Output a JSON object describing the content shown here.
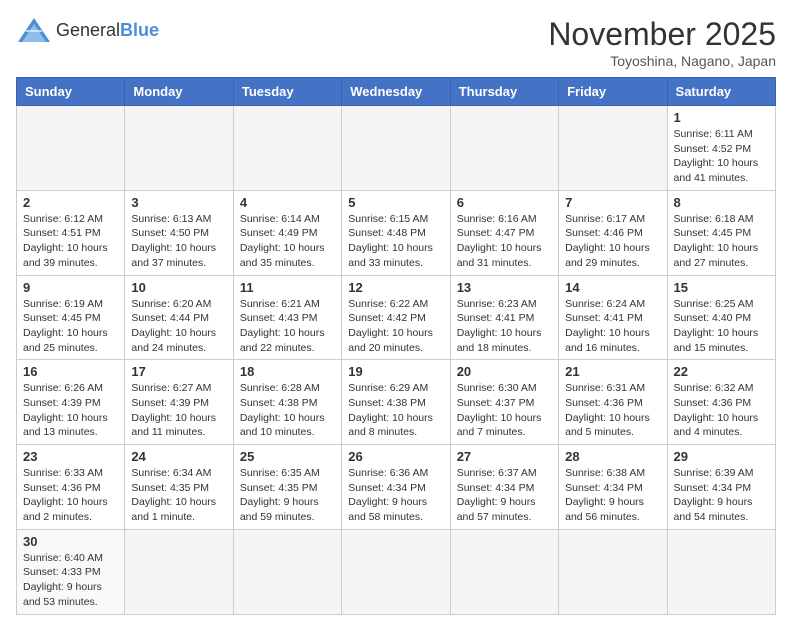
{
  "header": {
    "logo_general": "General",
    "logo_blue": "Blue",
    "title": "November 2025",
    "subtitle": "Toyoshina, Nagano, Japan"
  },
  "weekdays": [
    "Sunday",
    "Monday",
    "Tuesday",
    "Wednesday",
    "Thursday",
    "Friday",
    "Saturday"
  ],
  "weeks": [
    [
      {
        "day": "",
        "info": ""
      },
      {
        "day": "",
        "info": ""
      },
      {
        "day": "",
        "info": ""
      },
      {
        "day": "",
        "info": ""
      },
      {
        "day": "",
        "info": ""
      },
      {
        "day": "",
        "info": ""
      },
      {
        "day": "1",
        "info": "Sunrise: 6:11 AM\nSunset: 4:52 PM\nDaylight: 10 hours and 41 minutes."
      }
    ],
    [
      {
        "day": "2",
        "info": "Sunrise: 6:12 AM\nSunset: 4:51 PM\nDaylight: 10 hours and 39 minutes."
      },
      {
        "day": "3",
        "info": "Sunrise: 6:13 AM\nSunset: 4:50 PM\nDaylight: 10 hours and 37 minutes."
      },
      {
        "day": "4",
        "info": "Sunrise: 6:14 AM\nSunset: 4:49 PM\nDaylight: 10 hours and 35 minutes."
      },
      {
        "day": "5",
        "info": "Sunrise: 6:15 AM\nSunset: 4:48 PM\nDaylight: 10 hours and 33 minutes."
      },
      {
        "day": "6",
        "info": "Sunrise: 6:16 AM\nSunset: 4:47 PM\nDaylight: 10 hours and 31 minutes."
      },
      {
        "day": "7",
        "info": "Sunrise: 6:17 AM\nSunset: 4:46 PM\nDaylight: 10 hours and 29 minutes."
      },
      {
        "day": "8",
        "info": "Sunrise: 6:18 AM\nSunset: 4:45 PM\nDaylight: 10 hours and 27 minutes."
      }
    ],
    [
      {
        "day": "9",
        "info": "Sunrise: 6:19 AM\nSunset: 4:45 PM\nDaylight: 10 hours and 25 minutes."
      },
      {
        "day": "10",
        "info": "Sunrise: 6:20 AM\nSunset: 4:44 PM\nDaylight: 10 hours and 24 minutes."
      },
      {
        "day": "11",
        "info": "Sunrise: 6:21 AM\nSunset: 4:43 PM\nDaylight: 10 hours and 22 minutes."
      },
      {
        "day": "12",
        "info": "Sunrise: 6:22 AM\nSunset: 4:42 PM\nDaylight: 10 hours and 20 minutes."
      },
      {
        "day": "13",
        "info": "Sunrise: 6:23 AM\nSunset: 4:41 PM\nDaylight: 10 hours and 18 minutes."
      },
      {
        "day": "14",
        "info": "Sunrise: 6:24 AM\nSunset: 4:41 PM\nDaylight: 10 hours and 16 minutes."
      },
      {
        "day": "15",
        "info": "Sunrise: 6:25 AM\nSunset: 4:40 PM\nDaylight: 10 hours and 15 minutes."
      }
    ],
    [
      {
        "day": "16",
        "info": "Sunrise: 6:26 AM\nSunset: 4:39 PM\nDaylight: 10 hours and 13 minutes."
      },
      {
        "day": "17",
        "info": "Sunrise: 6:27 AM\nSunset: 4:39 PM\nDaylight: 10 hours and 11 minutes."
      },
      {
        "day": "18",
        "info": "Sunrise: 6:28 AM\nSunset: 4:38 PM\nDaylight: 10 hours and 10 minutes."
      },
      {
        "day": "19",
        "info": "Sunrise: 6:29 AM\nSunset: 4:38 PM\nDaylight: 10 hours and 8 minutes."
      },
      {
        "day": "20",
        "info": "Sunrise: 6:30 AM\nSunset: 4:37 PM\nDaylight: 10 hours and 7 minutes."
      },
      {
        "day": "21",
        "info": "Sunrise: 6:31 AM\nSunset: 4:36 PM\nDaylight: 10 hours and 5 minutes."
      },
      {
        "day": "22",
        "info": "Sunrise: 6:32 AM\nSunset: 4:36 PM\nDaylight: 10 hours and 4 minutes."
      }
    ],
    [
      {
        "day": "23",
        "info": "Sunrise: 6:33 AM\nSunset: 4:36 PM\nDaylight: 10 hours and 2 minutes."
      },
      {
        "day": "24",
        "info": "Sunrise: 6:34 AM\nSunset: 4:35 PM\nDaylight: 10 hours and 1 minute."
      },
      {
        "day": "25",
        "info": "Sunrise: 6:35 AM\nSunset: 4:35 PM\nDaylight: 9 hours and 59 minutes."
      },
      {
        "day": "26",
        "info": "Sunrise: 6:36 AM\nSunset: 4:34 PM\nDaylight: 9 hours and 58 minutes."
      },
      {
        "day": "27",
        "info": "Sunrise: 6:37 AM\nSunset: 4:34 PM\nDaylight: 9 hours and 57 minutes."
      },
      {
        "day": "28",
        "info": "Sunrise: 6:38 AM\nSunset: 4:34 PM\nDaylight: 9 hours and 56 minutes."
      },
      {
        "day": "29",
        "info": "Sunrise: 6:39 AM\nSunset: 4:34 PM\nDaylight: 9 hours and 54 minutes."
      }
    ],
    [
      {
        "day": "30",
        "info": "Sunrise: 6:40 AM\nSunset: 4:33 PM\nDaylight: 9 hours and 53 minutes."
      },
      {
        "day": "",
        "info": ""
      },
      {
        "day": "",
        "info": ""
      },
      {
        "day": "",
        "info": ""
      },
      {
        "day": "",
        "info": ""
      },
      {
        "day": "",
        "info": ""
      },
      {
        "day": "",
        "info": ""
      }
    ]
  ]
}
